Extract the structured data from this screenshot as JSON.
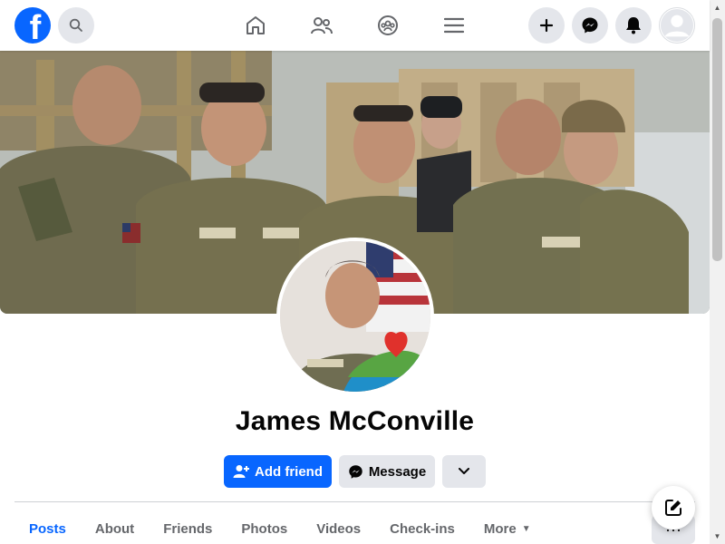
{
  "topbar": {
    "logo_letter": "f",
    "search_icon": "search-icon",
    "nav": [
      {
        "name": "home",
        "icon": "home-icon"
      },
      {
        "name": "friends",
        "icon": "friends-icon"
      },
      {
        "name": "groups",
        "icon": "groups-icon"
      },
      {
        "name": "menu",
        "icon": "hamburger-icon"
      }
    ],
    "actions": [
      {
        "name": "create",
        "icon": "plus-icon"
      },
      {
        "name": "messenger",
        "icon": "messenger-icon"
      },
      {
        "name": "notifications",
        "icon": "bell-icon"
      },
      {
        "name": "account",
        "icon": "avatar-icon"
      }
    ]
  },
  "profile": {
    "name": "James McConville",
    "cover_description_icon": "cover-photo",
    "badges": [
      "U.S.ARMY",
      "MILLER",
      "U.S.ARMY",
      "U.S.ARMY",
      "MCCONVILLE"
    ]
  },
  "buttons": {
    "add_friend": "Add friend",
    "message": "Message",
    "more_icon": "chevron-down-icon"
  },
  "tabs": [
    {
      "label": "Posts",
      "active": true
    },
    {
      "label": "About",
      "active": false
    },
    {
      "label": "Friends",
      "active": false
    },
    {
      "label": "Photos",
      "active": false
    },
    {
      "label": "Videos",
      "active": false
    },
    {
      "label": "Check-ins",
      "active": false
    },
    {
      "label": "More",
      "active": false
    }
  ],
  "colors": {
    "brand": "#0866ff",
    "secondary_bg": "#e4e6eb",
    "muted_text": "#65676b"
  }
}
